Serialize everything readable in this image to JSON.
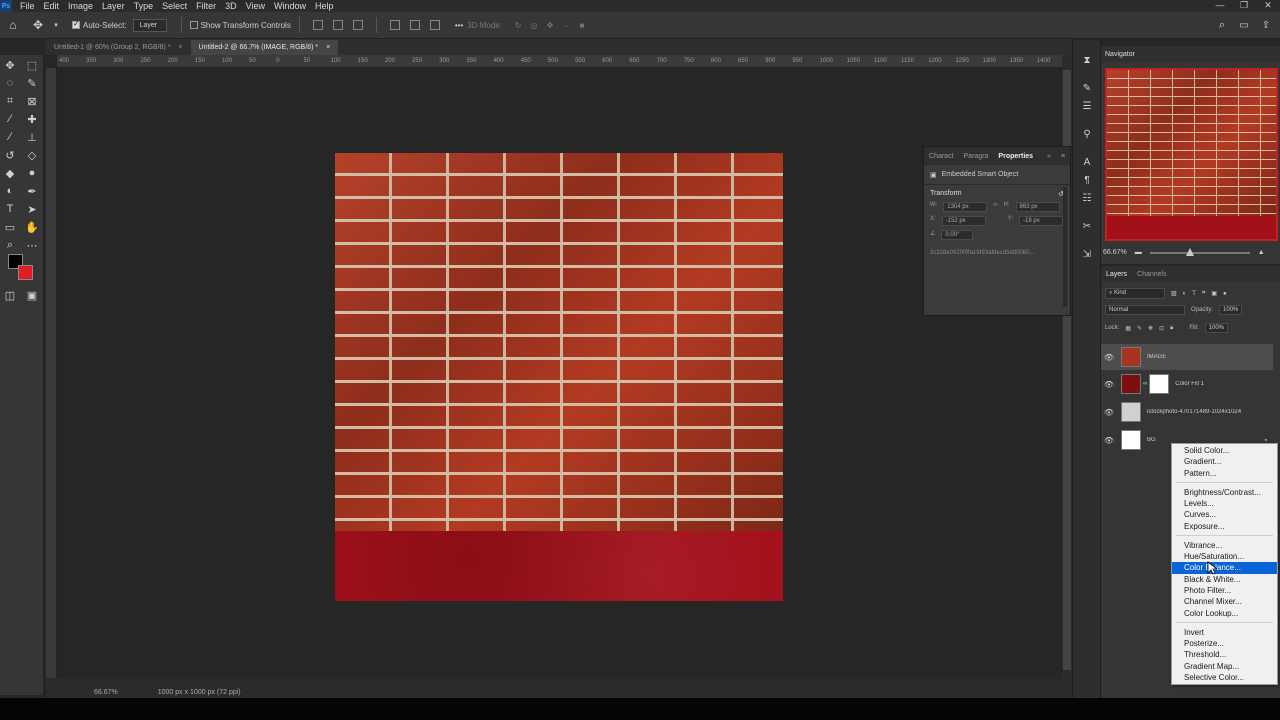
{
  "menubar": {
    "logo": "Ps",
    "items": [
      "File",
      "Edit",
      "Image",
      "Layer",
      "Type",
      "Select",
      "Filter",
      "3D",
      "View",
      "Window",
      "Help"
    ],
    "win_controls": [
      "—",
      "❐",
      "✕"
    ]
  },
  "options_bar": {
    "auto_select_label": "Auto-Select:",
    "auto_select_value": "Layer",
    "show_transform_label": "Show Transform Controls",
    "more": "•••",
    "mode3d": "3D Mode:"
  },
  "tabs": [
    {
      "label": "Untitled-1 @ 60% (Group 2, RGB/8) *",
      "close": "×"
    },
    {
      "label": "Untitled-2 @ 66.7% (IMAGE, RGB/8) *",
      "close": "×"
    }
  ],
  "ruler_ticks": [
    "400",
    "350",
    "300",
    "250",
    "200",
    "150",
    "100",
    "50",
    "0",
    "50",
    "100",
    "150",
    "200",
    "250",
    "300",
    "350",
    "400",
    "450",
    "500",
    "550",
    "600",
    "650",
    "700",
    "750",
    "800",
    "850",
    "900",
    "950",
    "1000",
    "1050",
    "1100",
    "1150",
    "1200",
    "1250",
    "1300",
    "1350",
    "1400"
  ],
  "status": {
    "zoom": "66.67%",
    "doc_size": "1000 px x 1000 px (72 ppi)"
  },
  "properties": {
    "tabs": [
      "Charact",
      "Paragra",
      "Properties"
    ],
    "embedded": "Embedded Smart Object",
    "transform_label": "Transform",
    "w_label": "W:",
    "w_value": "1304 px",
    "h_label": "H:",
    "h_value": "863 px",
    "x_label": "X:",
    "x_value": "-152 px",
    "y_label": "Y:",
    "y_value": "-18 px",
    "angle_value": "0.00°",
    "hash": "3c22de0920f9fa1fd93afdecd5dd0060..."
  },
  "navigator": {
    "title": "Navigator",
    "zoom": "66.67%"
  },
  "layers_panel": {
    "tabs": [
      "Layers",
      "Channels"
    ],
    "kind": "Kind",
    "blend_mode": "Normal",
    "opacity_label": "Opacity:",
    "opacity_value": "100%",
    "lock_label": "Lock:",
    "fill_label": "Fill:",
    "fill_value": "100%",
    "layers": [
      {
        "name": "IMAGE"
      },
      {
        "name": "Color Fill 1"
      },
      {
        "name": "istockphoto-470171489-1024x1024"
      },
      {
        "name": "BG"
      }
    ]
  },
  "adjustment_menu": {
    "group1": [
      "Solid Color...",
      "Gradient...",
      "Pattern..."
    ],
    "group2": [
      "Brightness/Contrast...",
      "Levels...",
      "Curves...",
      "Exposure..."
    ],
    "group3": [
      "Vibrance...",
      "Hue/Saturation...",
      "Color Balance...",
      "Black & White...",
      "Photo Filter...",
      "Channel Mixer...",
      "Color Lookup..."
    ],
    "group4": [
      "Invert",
      "Posterize...",
      "Threshold...",
      "Gradient Map...",
      "Selective Color..."
    ],
    "highlighted": "Color Balance..."
  },
  "colors": {
    "foreground": "#000000",
    "background": "#e01b24",
    "highlight": "#0a64d6"
  }
}
